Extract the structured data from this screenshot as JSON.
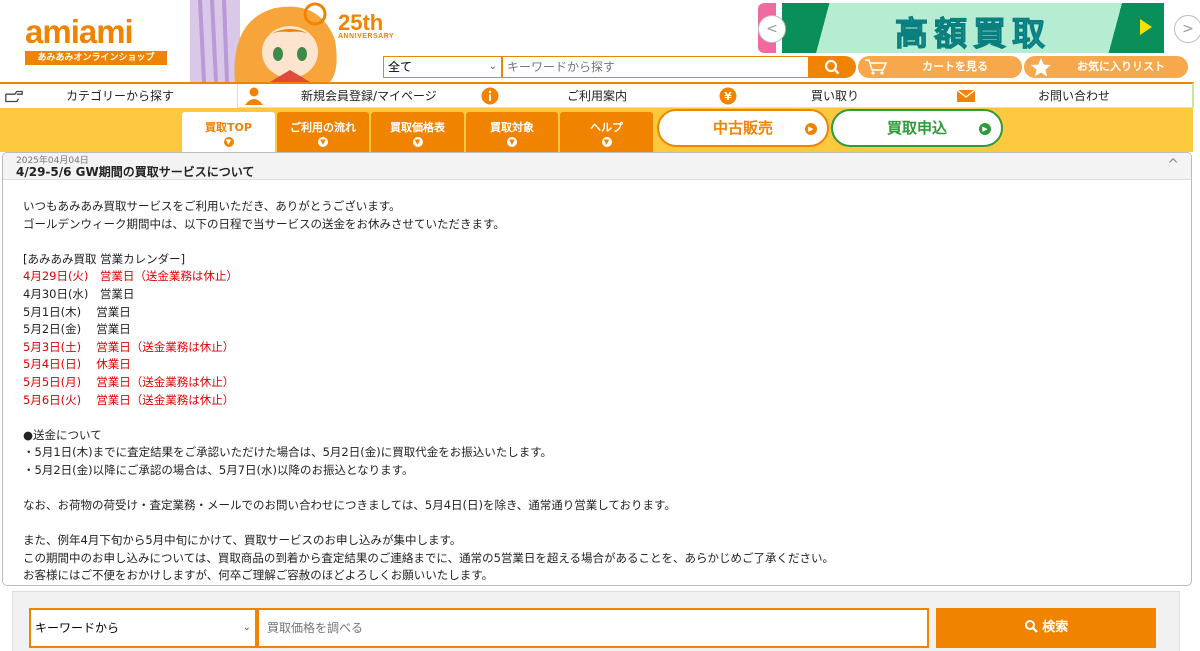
{
  "header": {
    "logo_text": "amiami",
    "logo_sub": "あみあみオンラインショップ",
    "anniversary_number": "25th",
    "anniversary_text": "ANNIVERSARY",
    "category_value": "全て",
    "search_placeholder": "キーワードから探す",
    "cart_label": "カートを見る",
    "favorites_label": "お気に入りリスト",
    "banner_text": "高額買取"
  },
  "nav": {
    "category": "カテゴリーから探す",
    "register": "新規会員登録/マイページ",
    "guide": "ご利用案内",
    "buyback": "買い取り",
    "contact": "お問い合わせ"
  },
  "tabs": [
    {
      "label": "買取TOP"
    },
    {
      "label": "ご利用の流れ"
    },
    {
      "label": "買取価格表"
    },
    {
      "label": "買取対象"
    },
    {
      "label": "ヘルプ"
    }
  ],
  "pills": {
    "used": "中古販売",
    "apply": "買取申込"
  },
  "notice": {
    "date": "2025年04月04日",
    "title": "4/29-5/6 GW期間の買取サービスについて",
    "lines": [
      {
        "text": "いつもあみあみ買取サービスをご利用いただき、ありがとうございます。",
        "red": false
      },
      {
        "text": "ゴールデンウィーク期間中は、以下の日程で当サービスの送金をお休みさせていただきます。",
        "red": false
      },
      {
        "text": "",
        "red": false
      },
      {
        "text": "[あみあみ買取 営業カレンダー]",
        "red": false
      },
      {
        "text": "4月29日(火)　営業日（送金業務は休止）",
        "red": true
      },
      {
        "text": "4月30日(水)　営業日",
        "red": false
      },
      {
        "text": "5月1日(木)　 営業日",
        "red": false
      },
      {
        "text": "5月2日(金)　 営業日",
        "red": false
      },
      {
        "text": "5月3日(土)　 営業日（送金業務は休止）",
        "red": true
      },
      {
        "text": "5月4日(日)　 休業日",
        "red": true
      },
      {
        "text": "5月5日(月)　 営業日（送金業務は休止）",
        "red": true
      },
      {
        "text": "5月6日(火)　 営業日（送金業務は休止）",
        "red": true
      },
      {
        "text": "",
        "red": false
      },
      {
        "text": "●送金について",
        "red": false
      },
      {
        "text": "・5月1日(木)までに査定結果をご承認いただけた場合は、5月2日(金)に買取代金をお振込いたします。",
        "red": false
      },
      {
        "text": "・5月2日(金)以降にご承認の場合は、5月7日(水)以降のお振込となります。",
        "red": false
      },
      {
        "text": "",
        "red": false
      },
      {
        "text": "なお、お荷物の荷受け・査定業務・メールでのお問い合わせにつきましては、5月4日(日)を除き、通常通り営業しております。",
        "red": false
      },
      {
        "text": "",
        "red": false
      },
      {
        "text": "また、例年4月下旬から5月中旬にかけて、買取サービスのお申し込みが集中します。",
        "red": false
      },
      {
        "text": "この期間中のお申し込みについては、買取商品の到着から査定結果のご連絡までに、通常の5営業日を超える場合があることを、あらかじめご了承ください。",
        "red": false
      },
      {
        "text": "お客様にはご不便をおかけしますが、何卒ご理解ご容赦のほどよろしくお願いいたします。",
        "red": false
      }
    ]
  },
  "bottom_search": {
    "select_value": "キーワードから",
    "placeholder": "買取価格を調べる",
    "button_label": "検索"
  },
  "colors": {
    "brand_orange": "#f08300",
    "tab_band": "#fcc83e",
    "alert_red": "#e00000",
    "apply_green": "#2e9a3a"
  }
}
